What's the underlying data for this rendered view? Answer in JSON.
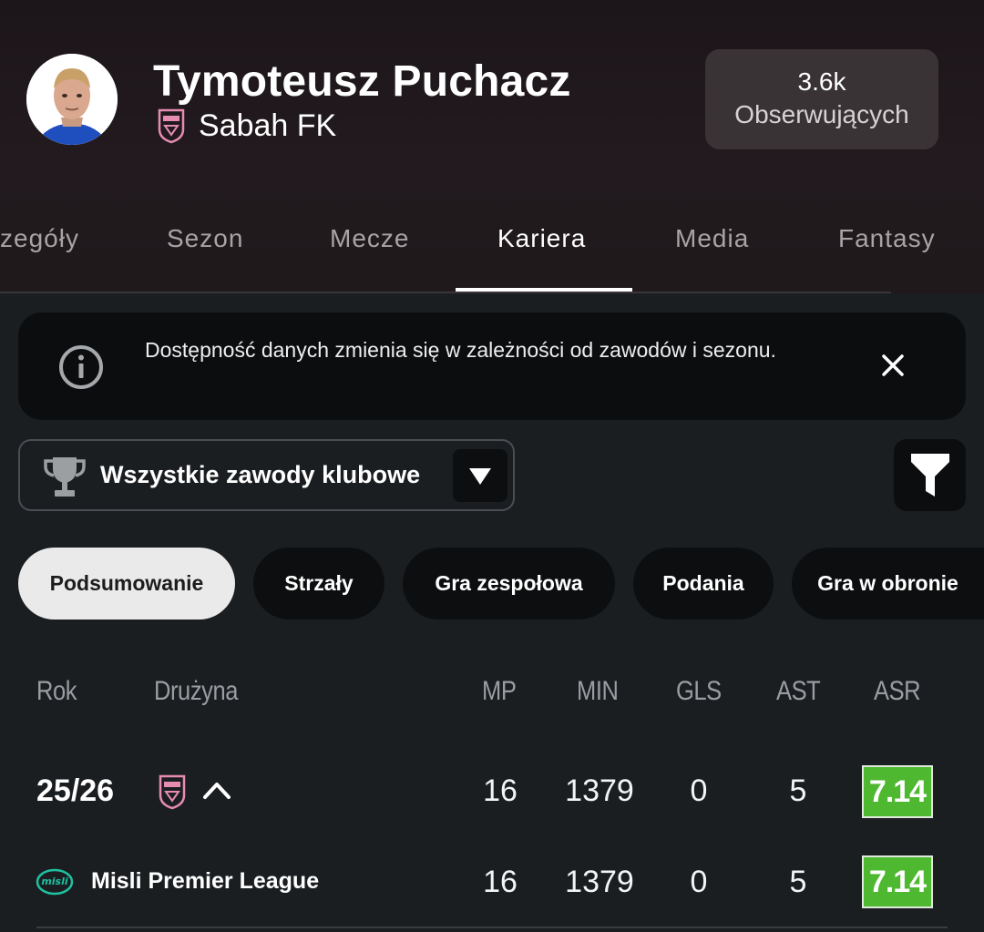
{
  "player": {
    "name": "Tymoteusz Puchacz",
    "club": "Sabah FK",
    "followers_count": "3.6k",
    "followers_label": "Obserwujących"
  },
  "tabs": [
    {
      "label": "zegóły",
      "active": false
    },
    {
      "label": "Sezon",
      "active": false
    },
    {
      "label": "Mecze",
      "active": false
    },
    {
      "label": "Kariera",
      "active": true
    },
    {
      "label": "Media",
      "active": false
    },
    {
      "label": "Fantasy",
      "active": false
    }
  ],
  "notice": {
    "text": "Dostępność danych zmienia się w zależności od zawodów i sezonu."
  },
  "filter": {
    "competition": "Wszystkie zawody klubowe"
  },
  "chips": [
    {
      "label": "Podsumowanie",
      "active": true
    },
    {
      "label": "Strzały",
      "active": false
    },
    {
      "label": "Gra zespołowa",
      "active": false
    },
    {
      "label": "Podania",
      "active": false
    },
    {
      "label": "Gra w obronie",
      "active": false
    }
  ],
  "table": {
    "headers": {
      "year": "Rok",
      "team": "Drużyna",
      "mp": "MP",
      "min": "MIN",
      "gls": "GLS",
      "ast": "AST",
      "asr": "ASR"
    },
    "season_row": {
      "year": "25/26",
      "mp": "16",
      "min": "1379",
      "gls": "0",
      "ast": "5",
      "asr": "7.14"
    },
    "competition_row": {
      "name": "Misli Premier League",
      "mp": "16",
      "min": "1379",
      "gls": "0",
      "ast": "5",
      "asr": "7.14"
    }
  },
  "colors": {
    "rating_green": "#4fb831",
    "background": "#1b1e21",
    "header": "#1f181c"
  }
}
